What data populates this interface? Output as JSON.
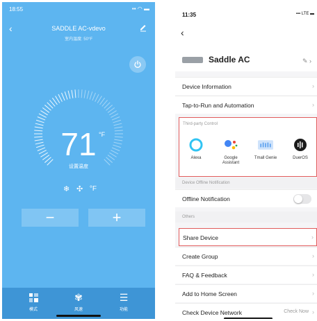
{
  "left_app": {
    "status_time": "18:55",
    "title": "SADDLE AC-vdevo",
    "subtitle": "室内温度: 50°F",
    "temperature": "71",
    "temp_unit": "°F",
    "temp_label": "设置温度",
    "mode_unit": "°F",
    "minus_label": "−",
    "plus_label": "+",
    "tabs": [
      {
        "label": "模式",
        "icon": "grid-icon"
      },
      {
        "label": "风速",
        "icon": "fan-icon"
      },
      {
        "label": "功能",
        "icon": "menu-icon"
      }
    ],
    "colors": {
      "background": "#5db5f0",
      "tabbar": "#3e95d6"
    }
  },
  "right_app": {
    "status_time": "11:35",
    "status_network": "LTE",
    "device_name": "Saddle AC",
    "rows_top": [
      {
        "label": "Device Information"
      },
      {
        "label": "Tap-to-Run and Automation"
      }
    ],
    "third_party": {
      "section": "Third-party Control",
      "services": [
        {
          "name": "Alexa",
          "icon": "alexa-icon"
        },
        {
          "name": "Google\nAssistant",
          "icon": "google-assistant-icon"
        },
        {
          "name": "Tmall Genie",
          "icon": "tmall-genie-icon"
        },
        {
          "name": "DuerOS",
          "icon": "dueros-icon"
        }
      ]
    },
    "offline_section": "Device Offline Notification",
    "offline_label": "Offline Notification",
    "offline_enabled": false,
    "others_section": "Others",
    "rows_bottom": [
      {
        "label": "Share Device"
      },
      {
        "label": "Create Group"
      },
      {
        "label": "FAQ & Feedback"
      },
      {
        "label": "Add to Home Screen"
      },
      {
        "label": "Check Device Network",
        "value": "Check Now"
      }
    ],
    "colors": {
      "highlight": "#e15b5b"
    }
  }
}
